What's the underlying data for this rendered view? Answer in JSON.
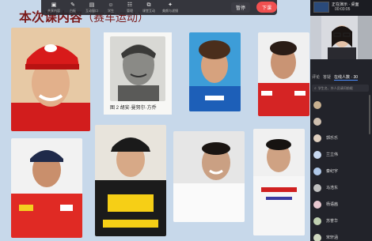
{
  "slide": {
    "title_main": "本次课内容",
    "title_sub": "（赛车运动）",
    "caption": "图 2  胡安·曼努尔·方乔"
  },
  "toolbar": {
    "items": [
      {
        "icon": "▣",
        "label": "共享内容"
      },
      {
        "icon": "✎",
        "label": "白板"
      },
      {
        "icon": "▤",
        "label": "互动窗口"
      },
      {
        "icon": "☺",
        "label": "学生"
      },
      {
        "icon": "☷",
        "label": "管理"
      },
      {
        "icon": "⧉",
        "label": "课堂互动"
      },
      {
        "icon": "✦",
        "label": "美颜与滤镜"
      }
    ],
    "pause_label": "暂停",
    "end_label": "下课"
  },
  "panel": {
    "live_label": "正在演示 · 桌面",
    "timer": "00:03:05",
    "tabs": [
      "评论",
      "答疑",
      "在线人数 · 30"
    ],
    "search_placeholder": "学生名、外人员请问前缀",
    "users": [
      {
        "name": "",
        "color": "#c8b090"
      },
      {
        "name": "",
        "color": "#d0c0b0"
      },
      {
        "name": "郭乐乐",
        "color": "#e0d0c0"
      },
      {
        "name": "兰立伟",
        "color": "#c8d8f0"
      },
      {
        "name": "秦纪宇",
        "color": "#b0c8e8"
      },
      {
        "name": "马浩东",
        "color": "#c0c0c0"
      },
      {
        "name": "杨语茜",
        "color": "#e8c8d0"
      },
      {
        "name": "苏誉华",
        "color": "#c0d0b0"
      },
      {
        "name": "宋轩涵",
        "color": "#d0d8c0"
      }
    ]
  },
  "colors": {
    "accent_end": "#f05050",
    "slide_bg": "#c7d8ea",
    "title": "#7a1a1a"
  }
}
